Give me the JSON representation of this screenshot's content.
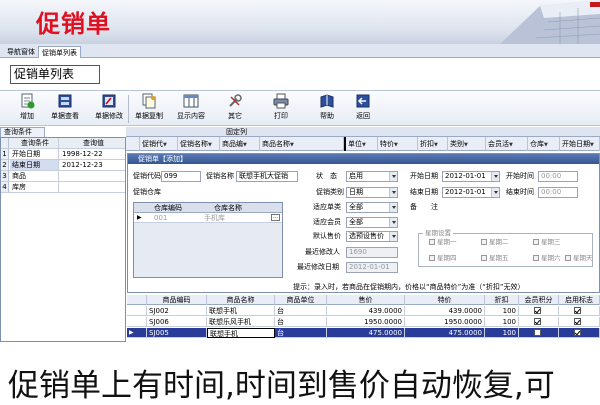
{
  "banner": {
    "title": "促销单"
  },
  "nav": {
    "tabs": [
      "导航窗体",
      "促销单列表"
    ]
  },
  "list_title": "促销单列表",
  "toolbar": {
    "buttons": [
      {
        "label": "增加",
        "icon": "add-doc-icon"
      },
      {
        "label": "单据查看",
        "icon": "view-doc-icon"
      },
      {
        "label": "单据修改",
        "icon": "edit-doc-icon"
      },
      {
        "label": "单据复制",
        "icon": "copy-doc-icon"
      },
      {
        "label": "显示内容",
        "icon": "columns-icon"
      },
      {
        "label": "其它",
        "icon": "tools-icon"
      },
      {
        "label": "打印",
        "icon": "printer-icon"
      },
      {
        "label": "帮助",
        "icon": "help-book-icon"
      },
      {
        "label": "返回",
        "icon": "return-icon"
      }
    ]
  },
  "query": {
    "tab": "查询条件",
    "headers": [
      "查询条件",
      "查询值"
    ],
    "rows": [
      {
        "n": "1",
        "cond": "开始日期",
        "val": "1998-12-22"
      },
      {
        "n": "2",
        "cond": "结束日期",
        "val": "2012-12-23"
      },
      {
        "n": "3",
        "cond": "商品",
        "val": ""
      },
      {
        "n": "4",
        "cond": "库房",
        "val": ""
      }
    ]
  },
  "grid": {
    "fixed_col": "固定列",
    "columns": [
      "促销代",
      "促销名称",
      "商品编",
      "商品名称",
      "单位",
      "特价",
      "折扣",
      "类别",
      "会员活",
      "仓库",
      "开始日期"
    ]
  },
  "dialog": {
    "title": "促销单【添加】",
    "fields": {
      "code_label": "促销代码",
      "code_value": "099",
      "name_label": "促销名称",
      "name_value": "联想手机大促销",
      "state_label": "状　态",
      "state_value": "启用",
      "start_date_label": "开始日期",
      "start_date_value": "2012-01-01",
      "start_time_label": "开始时间",
      "start_time_value": "00:00",
      "store_label": "促销仓库",
      "type_label": "促销类别",
      "type_value": "日期",
      "end_date_label": "结束日期",
      "end_date_value": "2012-01-01",
      "end_time_label": "结束时间",
      "end_time_value": "00:00",
      "goods_type_label": "适应单类",
      "goods_type_value": "全部",
      "note_label": "备　　注",
      "member_label": "适应会员",
      "member_value": "全部",
      "price_label": "默认售价",
      "price_value": "选预设售价",
      "modifier_label": "最近修改人",
      "modifier_value": "1690",
      "modified_date_label": "最近修改日期",
      "modified_date_value": "2012-01-01"
    },
    "warehouse": {
      "headers": [
        "仓库编码",
        "仓库名称"
      ],
      "rows": [
        {
          "code": "001",
          "name": "手机库"
        }
      ]
    },
    "weekdays": {
      "label": "星期设置",
      "days": [
        "星期一",
        "星期二",
        "星期三",
        "星期四",
        "星期五",
        "星期六",
        "星期天"
      ]
    },
    "tip": "提示：录入时，若商品在促销期内，价格以“商品特价”为准（“折扣”无效）"
  },
  "items": {
    "headers": [
      "商品编码",
      "商品名称",
      "商品单位",
      "售价",
      "特价",
      "折扣",
      "会员积分",
      "启用标志"
    ],
    "rows": [
      {
        "code": "SJ002",
        "name": "联想手机",
        "unit": "台",
        "price": "439.0000",
        "special": "439.0000",
        "discount": "100",
        "points": true,
        "enabled": true,
        "selected": false
      },
      {
        "code": "SJ006",
        "name": "联想乐风手机",
        "unit": "台",
        "price": "1950.0000",
        "special": "1950.0000",
        "discount": "100",
        "points": true,
        "enabled": true,
        "selected": false
      },
      {
        "code": "SJ005",
        "name": "联想手机",
        "unit": "台",
        "price": "475.0000",
        "special": "475.0000",
        "discount": "100",
        "points": false,
        "enabled": true,
        "selected": true
      }
    ]
  },
  "caption": "促销单上有时间,时间到售价自动恢复,可",
  "colors": {
    "title_red": "#e01020",
    "selection_blue": "#2a3c9a",
    "dialog_title": "#34558f"
  }
}
